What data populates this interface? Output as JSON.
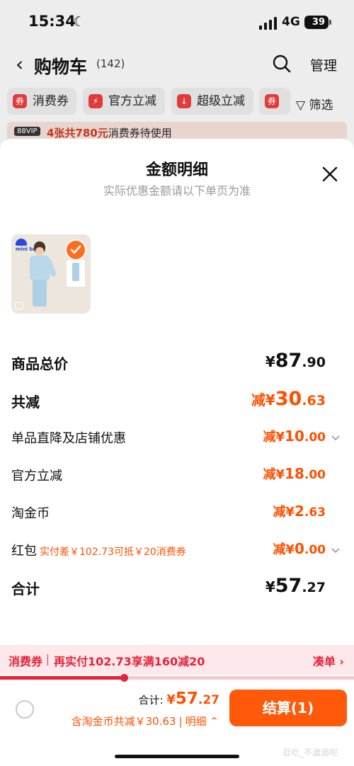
{
  "status_bar": {
    "time": "15:34",
    "network": "4G",
    "battery": "39"
  },
  "nav": {
    "title": "购物车",
    "count": "(142)",
    "manage": "管理"
  },
  "filters": {
    "chips": [
      "消费券",
      "官方立减",
      "超级立减"
    ],
    "filter_label": "筛选"
  },
  "vip_bar": {
    "tag": "88VIP",
    "highlight": "4张共780元",
    "text": "消费券待使用"
  },
  "sheet": {
    "title": "金额明细",
    "subtitle": "实际优惠金额请以下单页为准",
    "product_logo": "mini balo",
    "rows": [
      {
        "label": "商品总价",
        "prefix": "¥",
        "int": "87",
        "dec": ".90",
        "emphasis": "black"
      },
      {
        "label": "共减",
        "prefix": "减¥",
        "int": "30",
        "dec": ".63",
        "emphasis": "orange-large"
      },
      {
        "label": "单品直降及店铺优惠",
        "prefix": "减¥",
        "int": "10",
        "dec": ".00",
        "chevron": true
      },
      {
        "label": "官方立减",
        "prefix": "减¥",
        "int": "18",
        "dec": ".00"
      },
      {
        "label": "淘金币",
        "prefix": "减¥",
        "int": "2",
        "dec": ".63"
      },
      {
        "label": "红包",
        "hint": "实付差￥102.73可抵￥20消费券",
        "prefix": "减¥",
        "int": "0",
        "dec": ".00",
        "chevron": true
      },
      {
        "label": "合计",
        "prefix": "¥",
        "int": "57",
        "dec": ".27",
        "emphasis": "black-large"
      }
    ],
    "coupon_strip": {
      "label": "消费券",
      "text": "再实付102.73享满160减20",
      "link": "凑单 ›",
      "progress": 0.35
    },
    "footer": {
      "sum_label": "合计: ",
      "sum_prefix": "¥",
      "sum_int": "57",
      "sum_dec": ".27",
      "discount_text": "含淘金币共减￥30.63",
      "detail_label": "明细",
      "checkout_label": "结算(1)"
    },
    "watermark": "逛吃_不邋遢呢"
  },
  "colors": {
    "accent": "#ff5000",
    "coupon_red": "#e4243b",
    "checkout_bg": "#ff5a0a",
    "check_badge": "#ff6d1f"
  }
}
